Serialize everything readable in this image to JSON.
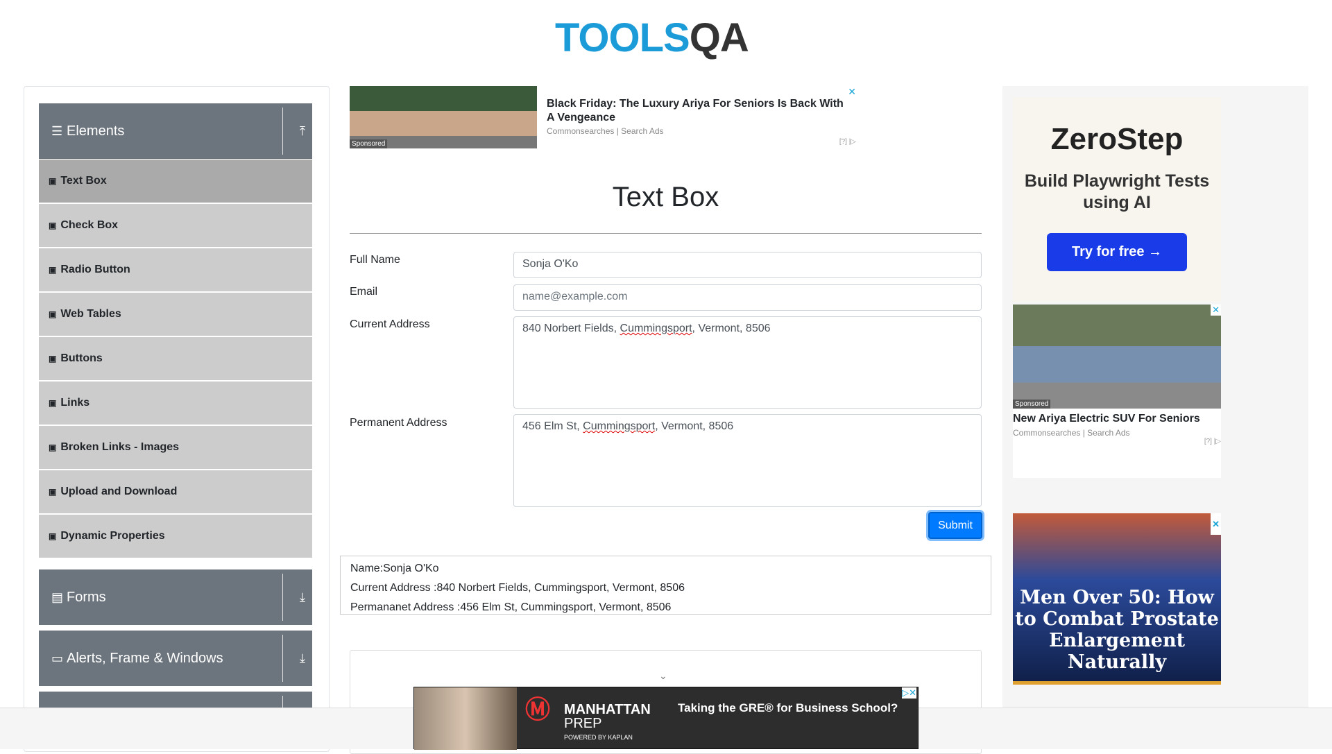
{
  "logo": {
    "text_a": "TOOLS",
    "text_b": "QA"
  },
  "sidebar": {
    "groups": [
      {
        "label": "Elements",
        "icon": "menu-icon",
        "arrow": "collapse-up-icon"
      },
      {
        "label": "Forms",
        "icon": "form-icon",
        "arrow": "expand-down-icon"
      },
      {
        "label": "Alerts, Frame & Windows",
        "icon": "window-icon",
        "arrow": "expand-down-icon"
      }
    ],
    "items": [
      {
        "label": "Text Box"
      },
      {
        "label": "Check Box"
      },
      {
        "label": "Radio Button"
      },
      {
        "label": "Web Tables"
      },
      {
        "label": "Buttons"
      },
      {
        "label": "Links"
      },
      {
        "label": "Broken Links - Images"
      },
      {
        "label": "Upload and Download"
      },
      {
        "label": "Dynamic Properties"
      }
    ],
    "active": "Text Box"
  },
  "ad_top": {
    "headline": "Black Friday: The Luxury Ariya For Seniors Is Back With A Vengeance",
    "source": "Commonsearches | Search Ads",
    "sponsored": "Sponsored",
    "close": "✕",
    "adchoices": "[?] |▷"
  },
  "page": {
    "title": "Text Box"
  },
  "form": {
    "full_name": {
      "label": "Full Name",
      "value": "Sonja O'Ko"
    },
    "email": {
      "label": "Email",
      "placeholder": "name@example.com"
    },
    "current_address": {
      "label": "Current Address",
      "pre": "840 Norbert Fields, ",
      "city": "Cummingsport",
      "post": ", Vermont, 8506"
    },
    "permanent_address": {
      "label": "Permanent Address",
      "pre": "456 Elm St, ",
      "city": "Cummingsport",
      "post": ", Vermont, 8506"
    },
    "submit": "Submit"
  },
  "output": {
    "name": "Name:Sonja O'Ko",
    "current": "Current Address :840 Norbert Fields, Cummingsport, Vermont, 8506",
    "permanent": "Permananet Address :456 Elm St, Cummingsport, Vermont, 8506"
  },
  "ad_bottom": {
    "brand": "MANHATTAN",
    "brand2": "PREP",
    "powered": "POWERED BY KAPLAN",
    "tagline": "Taking the GRE® for Business School?",
    "close": "▷✕"
  },
  "ad_right": {
    "zerostep": {
      "logo": "ZeroStep",
      "subtitle": "Build Playwright Tests using AI",
      "button": "Try for free →"
    },
    "car": {
      "headline": "New Ariya Electric SUV For Seniors",
      "source": "Commonsearches | Search Ads",
      "sponsored": "Sponsored",
      "adchoices": "[?] |▷",
      "close": "✕"
    },
    "prostate": {
      "headline": "Men Over 50: How to Combat Prostate Enlargement Naturally",
      "close": "✕"
    }
  }
}
